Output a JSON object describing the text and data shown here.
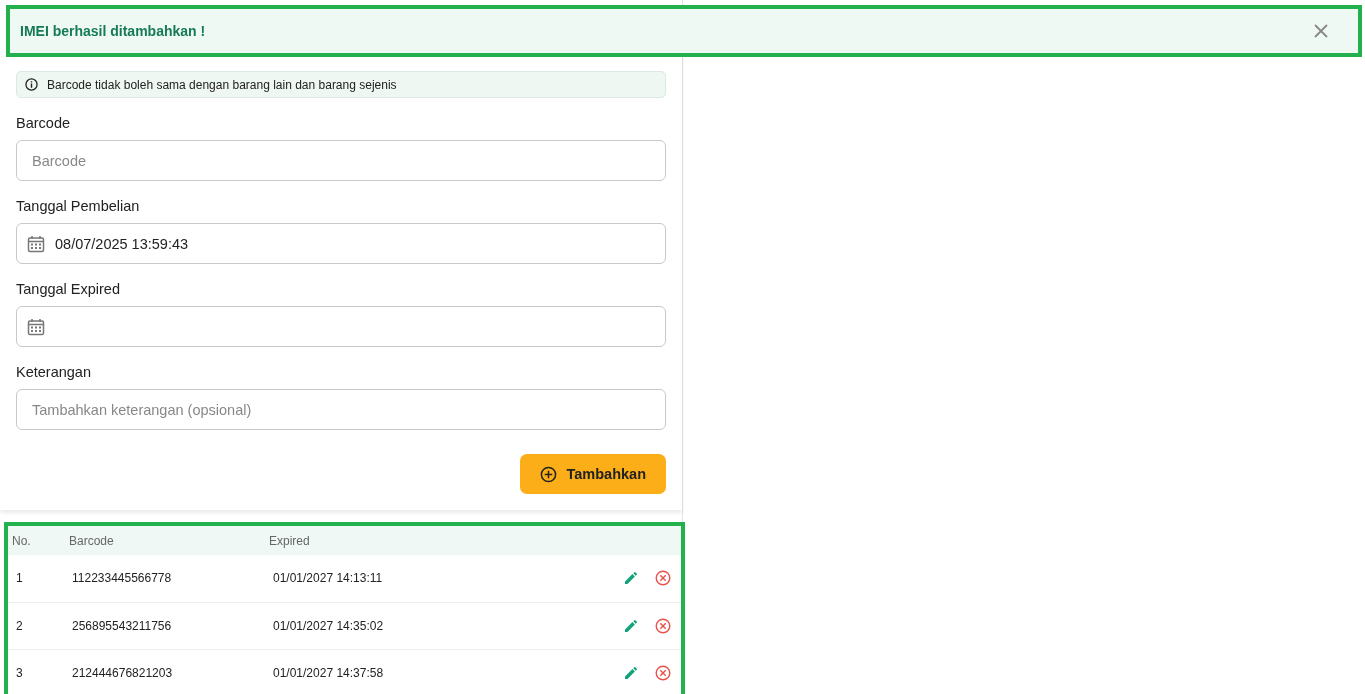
{
  "toast": {
    "message": "IMEI berhasil ditambahkan !"
  },
  "info": "Barcode tidak boleh sama dengan barang lain dan barang sejenis",
  "fields": [
    {
      "kind": "text",
      "label": "Barcode",
      "placeholder": "Barcode"
    },
    {
      "kind": "date",
      "label": "Tanggal Pembelian",
      "value": "08/07/2025 13:59:43"
    },
    {
      "kind": "date",
      "label": "Tanggal Expired"
    },
    {
      "kind": "text",
      "label": "Keterangan",
      "placeholder": "Tambahkan keterangan (opsional)"
    }
  ],
  "submit": "Tambahkan",
  "table": {
    "columns": [
      "No.",
      "Barcode",
      "Expired"
    ],
    "rows": [
      {
        "no": "1",
        "barcode": "112233445566778",
        "expired": "01/01/2027 14:13:11"
      },
      {
        "no": "2",
        "barcode": "256895543211756",
        "expired": "01/01/2027 14:35:02"
      },
      {
        "no": "3",
        "barcode": "212444676821203",
        "expired": "01/01/2027 14:37:58"
      }
    ]
  }
}
